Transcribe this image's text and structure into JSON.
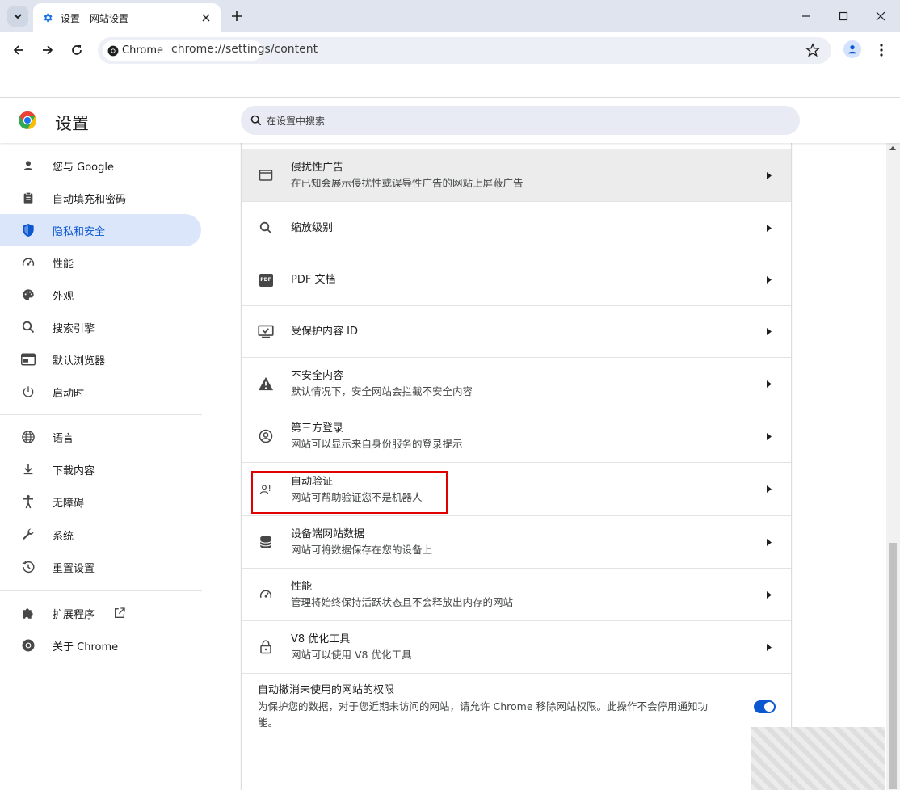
{
  "browser": {
    "tab_title": "设置 - 网站设置",
    "chip_label": "Chrome",
    "url": "chrome://settings/content"
  },
  "header": {
    "title": "设置",
    "search_placeholder": "在设置中搜索"
  },
  "sidebar": {
    "items": [
      {
        "label": "您与 Google",
        "icon": "person-icon"
      },
      {
        "label": "自动填充和密码",
        "icon": "clipboard-icon"
      },
      {
        "label": "隐私和安全",
        "icon": "shield-icon",
        "active": true
      },
      {
        "label": "性能",
        "icon": "speedometer-icon"
      },
      {
        "label": "外观",
        "icon": "palette-icon"
      },
      {
        "label": "搜索引擎",
        "icon": "search-icon"
      },
      {
        "label": "默认浏览器",
        "icon": "browser-window-icon"
      },
      {
        "label": "启动时",
        "icon": "power-icon"
      },
      {
        "label": "语言",
        "icon": "globe-icon"
      },
      {
        "label": "下载内容",
        "icon": "download-icon"
      },
      {
        "label": "无障碍",
        "icon": "accessibility-icon"
      },
      {
        "label": "系统",
        "icon": "wrench-icon"
      },
      {
        "label": "重置设置",
        "icon": "history-icon"
      },
      {
        "label": "扩展程序",
        "icon": "puzzle-icon"
      },
      {
        "label": "关于 Chrome",
        "icon": "chrome-icon"
      }
    ]
  },
  "content": {
    "rows": [
      {
        "title": "侵扰性广告",
        "subtitle": "在已知会展示侵扰性或误导性广告的网站上屏蔽广告",
        "icon": "ad-window-icon"
      },
      {
        "title": "缩放级别",
        "subtitle": "",
        "icon": "zoom-icon"
      },
      {
        "title": "PDF 文档",
        "subtitle": "",
        "icon": "pdf-icon",
        "icon_text": "PDF"
      },
      {
        "title": "受保护内容 ID",
        "subtitle": "",
        "icon": "protected-content-icon"
      },
      {
        "title": "不安全内容",
        "subtitle": "默认情况下，安全网站会拦截不安全内容",
        "icon": "warning-icon"
      },
      {
        "title": "第三方登录",
        "subtitle": "网站可以显示来自身份服务的登录提示",
        "icon": "account-circle-icon"
      },
      {
        "title": "自动验证",
        "subtitle": "网站可帮助验证您不是机器人",
        "icon": "person-check-icon"
      },
      {
        "title": "设备端网站数据",
        "subtitle": "网站可将数据保存在您的设备上",
        "icon": "database-icon"
      },
      {
        "title": "性能",
        "subtitle": "管理将始终保持活跃状态且不会释放出内存的网站",
        "icon": "speedometer-icon"
      },
      {
        "title": "V8 优化工具",
        "subtitle": "网站可以使用 V8 优化工具",
        "icon": "lock-icon"
      }
    ],
    "auto_revoke": {
      "title": "自动撤消未使用的网站的权限",
      "description": "为保护您的数据，对于您近期未访问的网站，请允许 Chrome 移除网站权限。此操作不会停用通知功能。",
      "enabled": true
    }
  },
  "colors": {
    "accent": "#0b57d0",
    "active_nav_bg": "#dbe6fb",
    "highlight_box": "#e00000"
  }
}
